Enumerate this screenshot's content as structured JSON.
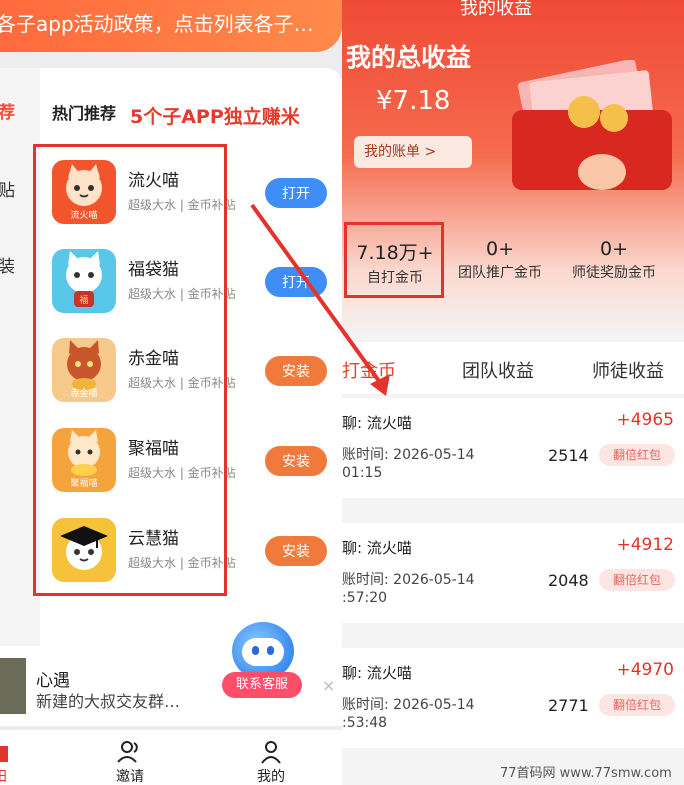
{
  "left": {
    "banner_text": "各子app活动政策，点击列表各子…",
    "rail_items": [
      {
        "label": "荐",
        "active": true
      },
      {
        "label": "贴",
        "active": false
      },
      {
        "label": "装",
        "active": false
      }
    ],
    "hot_title": "热门推荐",
    "overlay_title": "5个子APP独立赚米",
    "apps": [
      {
        "name": "流火喵",
        "sub": "超级大水 | 金币补贴",
        "button": "打开",
        "button_kind": "open",
        "icon_label": "流火喵",
        "icon_color": "#f2552c"
      },
      {
        "name": "福袋猫",
        "sub": "超级大水 | 金币补贴",
        "button": "打开",
        "button_kind": "open",
        "icon_label": "",
        "icon_color": "#58c7e8"
      },
      {
        "name": "赤金喵",
        "sub": "超级大水 | 金币补贴",
        "button": "安装",
        "button_kind": "install",
        "icon_label": "赤金喵",
        "icon_color": "#f7c98a"
      },
      {
        "name": "聚福喵",
        "sub": "超级大水 | 金币补贴",
        "button": "安装",
        "button_kind": "install",
        "icon_label": "聚福喵",
        "icon_color": "#f5a33c"
      },
      {
        "name": "云慧猫",
        "sub": "超级大水 | 金币补贴",
        "button": "安装",
        "button_kind": "install",
        "icon_label": "",
        "icon_color": "#f6c23a"
      }
    ],
    "chat": {
      "name": "心遇",
      "message": "新建的大叔交友群…",
      "close": "×"
    },
    "service_label": "联系客服",
    "tabbar": [
      {
        "label": "田",
        "icon": "home-icon"
      },
      {
        "label": "邀请",
        "icon": "people-icon"
      },
      {
        "label": "我的",
        "icon": "person-icon"
      }
    ]
  },
  "right": {
    "title": "我的收益",
    "total_label": "我的总收益",
    "total_value": "¥7.18",
    "bill_button": "我的账单 >",
    "stats": [
      {
        "value": "7.18万+",
        "label": "自打金币"
      },
      {
        "value": "0+",
        "label": "团队推广金币"
      },
      {
        "value": "0+",
        "label": "师徒奖励金币"
      }
    ],
    "tabs": [
      {
        "label": "自打金币",
        "active": true
      },
      {
        "label": "团队收益",
        "active": false
      },
      {
        "label": "师徒收益",
        "active": false
      }
    ],
    "records": [
      {
        "source": "聊: 流火喵",
        "amount": "+4965",
        "time": "账时间: 2026-05-14\n01:15",
        "coins": "2514",
        "tag": "翻倍红包"
      },
      {
        "source": "聊: 流火喵",
        "amount": "+4912",
        "time": "账时间: 2026-05-14\n:57:20",
        "coins": "2048",
        "tag": "翻倍红包"
      },
      {
        "source": "聊: 流火喵",
        "amount": "+4970",
        "time": "账时间: 2026-05-14\n:53:48",
        "coins": "2771",
        "tag": "翻倍红包"
      }
    ]
  },
  "watermark": "77首码网 www.77smw.com",
  "colors": {
    "accent_red": "#e2342d",
    "open_blue": "#3f8ef5",
    "install_orange": "#f07a3c"
  }
}
